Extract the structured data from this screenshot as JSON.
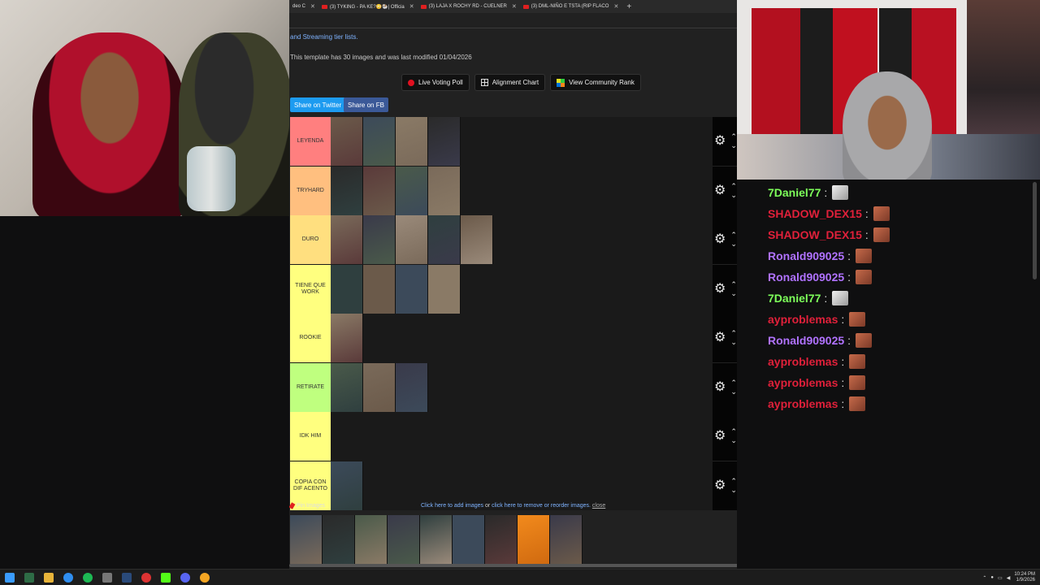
{
  "browser": {
    "tabs": [
      {
        "label": "deo C"
      },
      {
        "label": "(3) TYKING - PA KE?😳🐏| Officia"
      },
      {
        "label": "(3) LAJA X ROCHY RD - CUELNER"
      },
      {
        "label": "(3) DML-NIÑO E TSTA (RIP FLACO"
      }
    ],
    "new_tab": "+"
  },
  "page": {
    "streaming_link": "and Streaming tier lists.",
    "template_info": "This template has 30 images and was last modified 01/04/2026",
    "buttons": {
      "live_poll": "Live Voting Poll",
      "alignment": "Alignment Chart",
      "community": "View Community Rank"
    },
    "share_twitter": "Share on Twitter",
    "share_fb": "Share on FB",
    "pin_images": "Pin Images",
    "helper_add": "Click here to add images",
    "helper_or": " or ",
    "helper_remove": "click here to remove or reorder images.",
    "helper_close": "close"
  },
  "tiers": [
    {
      "label": "LEYENDA",
      "color": "#ff7f7f",
      "items": 4
    },
    {
      "label": "TRYHARD",
      "color": "#ffbf7f",
      "items": 4
    },
    {
      "label": "DURO",
      "color": "#ffdf7f",
      "items": 5
    },
    {
      "label": "TIENE QUE WORK",
      "color": "#ffff7f",
      "items": 4
    },
    {
      "label": "ROOKIE",
      "color": "#ffff7f",
      "items": 1
    },
    {
      "label": "RETIRATE",
      "color": "#bfff7f",
      "items": 3
    },
    {
      "label": "IDK HIM",
      "color": "#ffff7f",
      "items": 0
    },
    {
      "label": "COPIA CON DIF ACENTO",
      "color": "#ffff7f",
      "items": 1
    }
  ],
  "pool_count": 9,
  "chat": [
    {
      "user": "7Daniel77",
      "color": "#7dff5a",
      "emote": "white"
    },
    {
      "user": "SHADOW_DEX15",
      "color": "#e0203a",
      "emote": "red"
    },
    {
      "user": "SHADOW_DEX15",
      "color": "#e0203a",
      "emote": "red"
    },
    {
      "user": "Ronald909025",
      "color": "#b072ff",
      "emote": "red"
    },
    {
      "user": "Ronald909025",
      "color": "#b072ff",
      "emote": "red"
    },
    {
      "user": "7Daniel77",
      "color": "#7dff5a",
      "emote": "white"
    },
    {
      "user": "ayproblemas",
      "color": "#e0203a",
      "emote": "red"
    },
    {
      "user": "Ronald909025",
      "color": "#b072ff",
      "emote": "red"
    },
    {
      "user": "ayproblemas",
      "color": "#e0203a",
      "emote": "red"
    },
    {
      "user": "ayproblemas",
      "color": "#e0203a",
      "emote": "red"
    },
    {
      "user": "ayproblemas",
      "color": "#e0203a",
      "emote": "red"
    }
  ],
  "chat_separator": ":",
  "taskbar": {
    "time": "10:24 PM",
    "date": "1/9/2026"
  },
  "icons": {
    "gear": "⚙",
    "up": "⌃",
    "down": "⌄"
  }
}
